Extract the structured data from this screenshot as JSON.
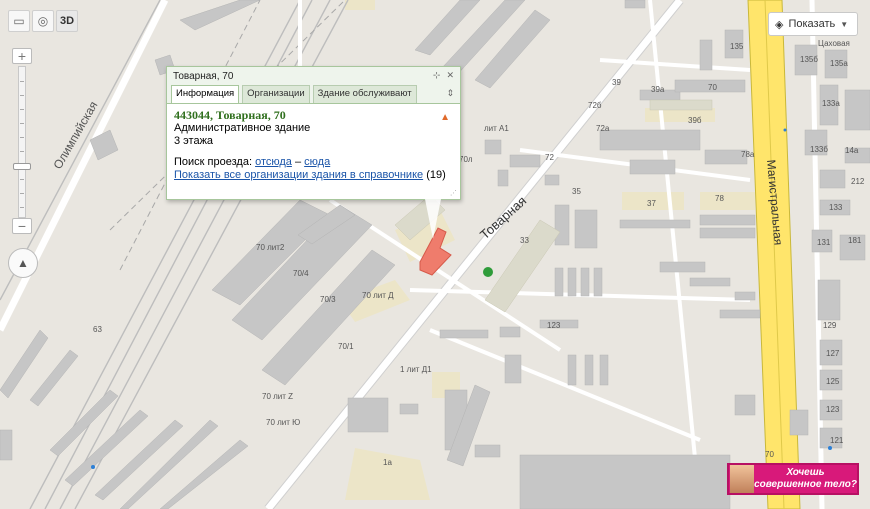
{
  "toolbar": {
    "ruler_icon": "ruler-icon",
    "traffic_icon": "traffic-icon",
    "mode_3d_label": "3D"
  },
  "zoom": {
    "plus": "+",
    "minus": "−",
    "level_fraction": 0.67
  },
  "compass": {
    "icon": "compass-icon"
  },
  "layers": {
    "label": "Показать"
  },
  "balloon": {
    "title": "Товарная, 70",
    "tabs": [
      "Информация",
      "Организации",
      "Здание обслуживают"
    ],
    "address": "443044, Товарная, 70",
    "building_type": "Административное здание",
    "floors": "3 этажа",
    "route_prefix": "Поиск проезда:",
    "route_from": "отсюда",
    "route_sep": "–",
    "route_to": "сюда",
    "show_all_link": "Показать все организации здания в справочнике",
    "org_count": "(19)"
  },
  "streets": {
    "olimpiyskaya": "Олимпийская",
    "tovarnaya": "Товарная",
    "magistralnaya": "Магистральная",
    "chakhovaya": "Цаховая"
  },
  "house_numbers": [
    "70 лит2",
    "70/4",
    "70/3",
    "70 лит Д",
    "70/1",
    "70 лит Z",
    "70 лит Ю",
    "1 лит Д1",
    "1а",
    "63",
    "123",
    "33",
    "35",
    "37",
    "78",
    "72",
    "72а",
    "72б",
    "39",
    "39а",
    "39б",
    "70",
    "70л",
    "лит А1",
    "78а",
    "135",
    "135б",
    "135а",
    "133а",
    "133б",
    "14а",
    "212",
    "133",
    "131",
    "181",
    "129",
    "127",
    "125",
    "123",
    "121",
    "70"
  ],
  "colors": {
    "map_bg": "#e9e6e0",
    "building": "#c4c4c4",
    "road": "#ffffff",
    "highway": "#ffe56b",
    "highway_border": "#c9b83a",
    "selected_building": "#ef7c6c",
    "balloon_border": "#a7c69c",
    "address_green": "#2f6f1d",
    "link_blue": "#1a54a8",
    "ad_pink": "#d8197a"
  },
  "ad": {
    "line1": "Хочешь",
    "line2": "совершенное тело?"
  }
}
